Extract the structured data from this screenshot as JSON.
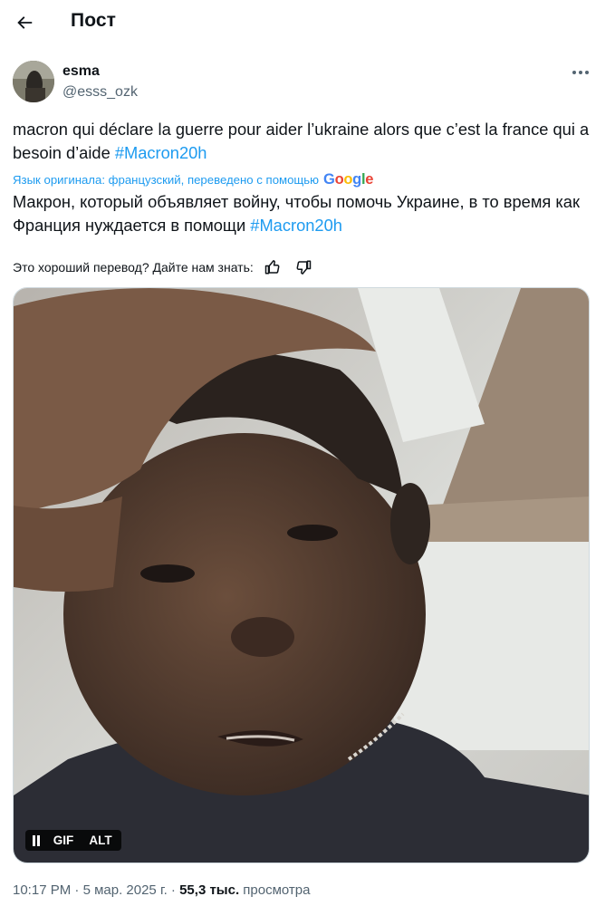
{
  "header": {
    "title": "Пост"
  },
  "author": {
    "name": "esma",
    "handle": "@esss_ozk"
  },
  "tweet": {
    "text": "macron qui déclare la guerre pour aider l’ukraine alors que c’est la france qui a besoin d’aide ",
    "hashtag": "#Macron20h"
  },
  "translation": {
    "note": "Язык оригинала: французский, переведено с помощью",
    "provider": "Google",
    "text": "Макрон, который объявляет войну, чтобы помочь Украине, в то время как Франция нуждается в помощи ",
    "hashtag": "#Macron20h"
  },
  "feedback": {
    "prompt": "Это хороший перевод? Дайте нам знать:"
  },
  "media": {
    "gif_label": "GIF",
    "alt_label": "ALT"
  },
  "meta": {
    "time": "10:17 PM",
    "date": "5 мар. 2025 г.",
    "views_count": "55,3 тыс.",
    "views_label": "просмотра"
  },
  "colors": {
    "accent": "#1d9bf0",
    "text": "#0f1419",
    "secondary": "#536471"
  },
  "icons": [
    "back-arrow-icon",
    "more-dots-icon",
    "thumbs-up-icon",
    "thumbs-down-icon",
    "pause-icon"
  ]
}
